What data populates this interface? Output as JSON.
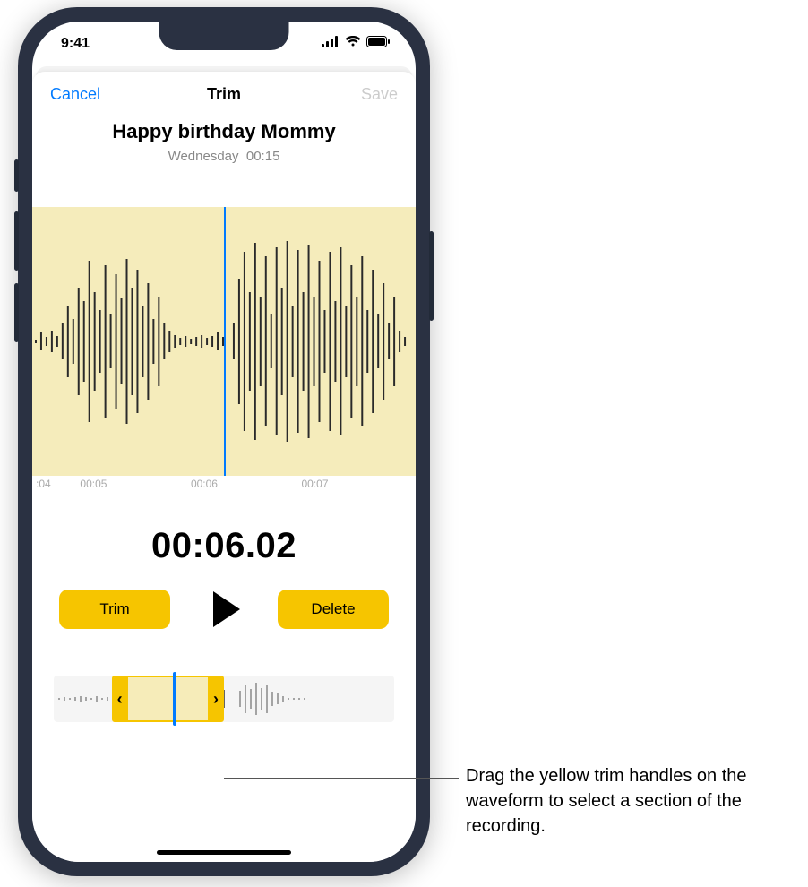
{
  "status": {
    "time": "9:41",
    "signal_icon": "cellular-signal-icon",
    "wifi_icon": "wifi-icon",
    "battery_icon": "battery-icon"
  },
  "sheet": {
    "cancel": "Cancel",
    "title": "Trim",
    "save": "Save"
  },
  "recording": {
    "title": "Happy birthday Mommy",
    "day": "Wednesday",
    "duration": "00:15"
  },
  "ticks": {
    "t1": ":04",
    "t2": "00:05",
    "t3": "00:06",
    "t4": "00:07"
  },
  "timecode": "00:06.02",
  "buttons": {
    "trim": "Trim",
    "delete": "Delete"
  },
  "mini": {
    "sel_left_pct": 17,
    "sel_width_pct": 33,
    "playhead_pct": 35
  },
  "callout": "Drag the yellow trim handles on the waveform to select a section of the recording.",
  "colors": {
    "accent": "#f6c500",
    "link": "#007aff",
    "wave_bg": "#f5ecbb"
  }
}
